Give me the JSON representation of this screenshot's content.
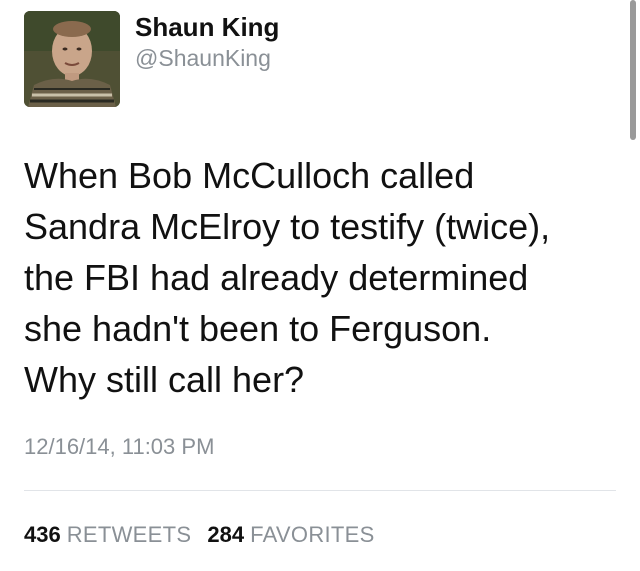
{
  "tweet": {
    "author": {
      "name": "Shaun King",
      "handle": "@ShaunKing",
      "avatar_icon": "profile-photo"
    },
    "text_lines": [
      "When Bob McCulloch called",
      "Sandra McElroy to testify (twice),",
      "the FBI had already determined",
      "she hadn't been to Ferguson.",
      "Why still call her?"
    ],
    "timestamp": "12/16/14, 11:03 PM",
    "stats": {
      "retweets_count": "436",
      "retweets_label": "RETWEETS",
      "favorites_count": "284",
      "favorites_label": "FAVORITES"
    }
  },
  "colors": {
    "primary_text": "#111111",
    "secondary_text": "#8a9096",
    "divider": "#e1e4e8"
  }
}
